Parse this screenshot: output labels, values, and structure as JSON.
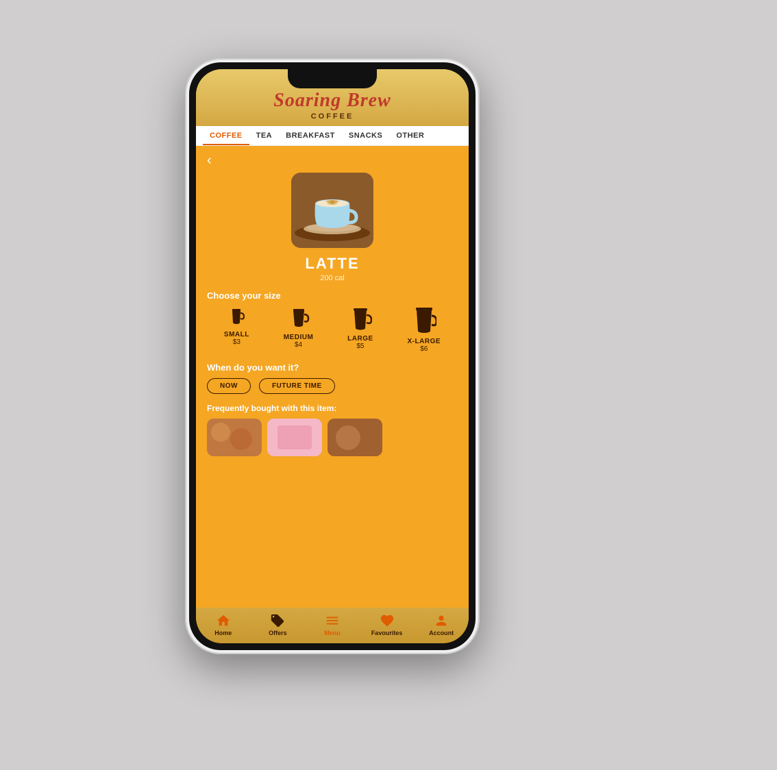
{
  "app": {
    "brand_script": "Soaring Brew",
    "brand_sub": "COFFEE"
  },
  "nav": {
    "tabs": [
      {
        "label": "COFFEE",
        "active": true
      },
      {
        "label": "TEA",
        "active": false
      },
      {
        "label": "BREAKFAST",
        "active": false
      },
      {
        "label": "SNACKS",
        "active": false
      },
      {
        "label": "OTHER",
        "active": false
      }
    ]
  },
  "product": {
    "name": "LATTE",
    "calories": "200 cal",
    "size_label": "Choose your size",
    "sizes": [
      {
        "name": "SMALL",
        "price": "$3"
      },
      {
        "name": "MEDIUM",
        "price": "$4"
      },
      {
        "name": "LARGE",
        "price": "$5"
      },
      {
        "name": "X-LARGE",
        "price": "$6"
      }
    ],
    "time_label": "When do you want it?",
    "time_options": [
      {
        "label": "NOW"
      },
      {
        "label": "FUTURE TIME"
      }
    ],
    "freq_label": "Frequently bought with this item:"
  },
  "bottom_nav": {
    "items": [
      {
        "label": "Home",
        "icon": "home-icon",
        "active": false
      },
      {
        "label": "Offers",
        "icon": "offers-icon",
        "active": false
      },
      {
        "label": "Menu",
        "icon": "menu-icon",
        "active": true
      },
      {
        "label": "Favourites",
        "icon": "favourites-icon",
        "active": false
      },
      {
        "label": "Account",
        "icon": "account-icon",
        "active": false
      }
    ]
  }
}
